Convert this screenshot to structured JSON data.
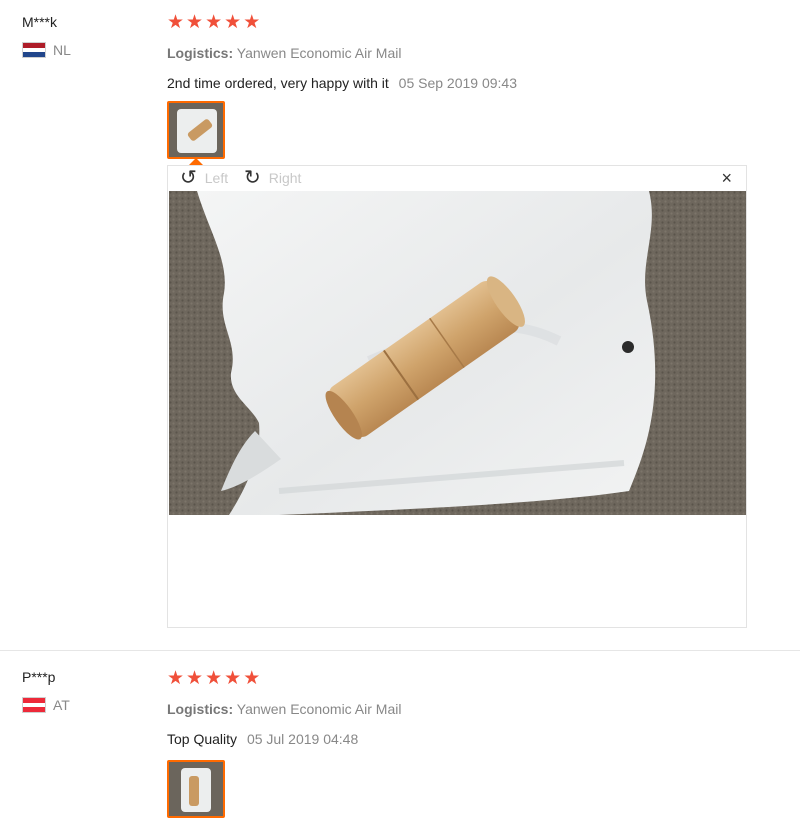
{
  "reviews": [
    {
      "username": "M***k",
      "country_code": "NL",
      "stars": [
        "★",
        "★",
        "★",
        "★",
        "★"
      ],
      "logistics_label": "Logistics:",
      "logistics_value": "Yanwen Economic Air Mail",
      "feedback": "2nd time ordered, very happy with it",
      "date": "05 Sep 2019 09:43",
      "flag_colors": [
        "#ae1c28",
        "#ffffff",
        "#21468b"
      ]
    },
    {
      "username": "P***p",
      "country_code": "AT",
      "stars": [
        "★",
        "★",
        "★",
        "★",
        "★"
      ],
      "logistics_label": "Logistics:",
      "logistics_value": "Yanwen Economic Air Mail",
      "feedback": "Top Quality",
      "date": "05 Jul 2019 04:48",
      "flag_colors": [
        "#ed2939",
        "#ffffff",
        "#ed2939"
      ]
    }
  ],
  "viewer": {
    "rotate_left_icon": "↺",
    "rotate_left_label": "Left",
    "rotate_right_icon": "↻",
    "rotate_right_label": "Right",
    "close_icon": "×"
  },
  "colors": {
    "star": "#f0503a",
    "thumb_border": "#ff6a00",
    "muted_text": "#888888"
  }
}
